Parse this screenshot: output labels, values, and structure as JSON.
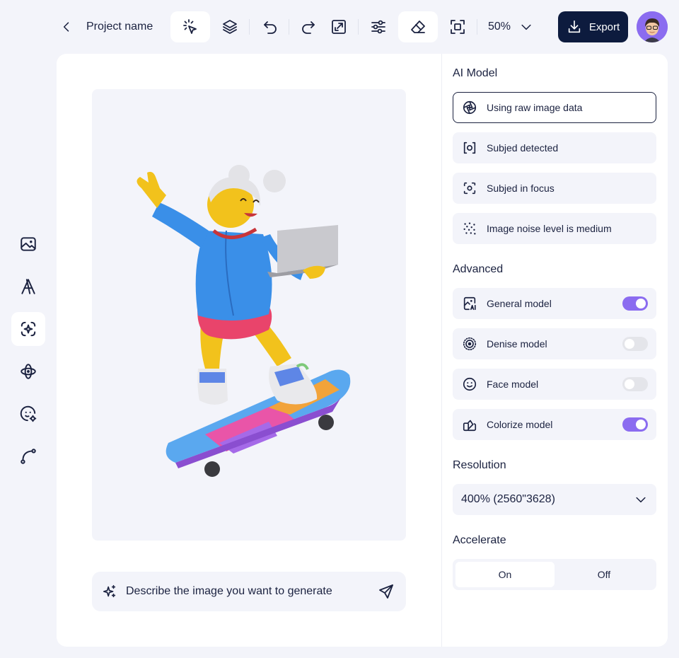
{
  "header": {
    "project_name": "Project name",
    "zoom": "50%",
    "export_label": "Export"
  },
  "toolbar": {
    "tools": [
      "select-sparkle",
      "layers",
      "undo",
      "redo",
      "resize",
      "adjust",
      "eraser",
      "crop-frame"
    ],
    "active_tools": [
      "select-sparkle",
      "eraser"
    ]
  },
  "rail": {
    "items": [
      "image-icon",
      "text-icon",
      "ai-select-icon",
      "shape-icon",
      "face-settings-icon",
      "curve-icon"
    ],
    "active": "ai-select-icon"
  },
  "prompt": {
    "placeholder": "Describe the image you want to generate"
  },
  "panel": {
    "ai_model": {
      "title": "AI Model",
      "options": [
        {
          "label": "Using raw image data",
          "icon": "aperture-icon",
          "selected": true
        },
        {
          "label": "Subjed detected",
          "icon": "scan-icon",
          "selected": false
        },
        {
          "label": "Subjed in focus",
          "icon": "focus-icon",
          "selected": false
        },
        {
          "label": "Image noise level is medium",
          "icon": "noise-icon",
          "selected": false
        }
      ]
    },
    "advanced": {
      "title": "Advanced",
      "models": [
        {
          "label": "General model",
          "icon": "ai-image-icon",
          "on": true
        },
        {
          "label": "Denise model",
          "icon": "denoise-icon",
          "on": false
        },
        {
          "label": "Face model",
          "icon": "smile-icon",
          "on": false
        },
        {
          "label": "Colorize model",
          "icon": "color-swatch-icon",
          "on": true
        }
      ]
    },
    "resolution": {
      "title": "Resolution",
      "value": "400% (2560\"3628)"
    },
    "accelerate": {
      "title": "Accelerate",
      "on_label": "On",
      "off_label": "Off",
      "selected": "On"
    }
  },
  "colors": {
    "accent": "#8b6cf0",
    "dark": "#0d1b3e",
    "text": "#1b2240",
    "surface": "#f3f4fa"
  }
}
